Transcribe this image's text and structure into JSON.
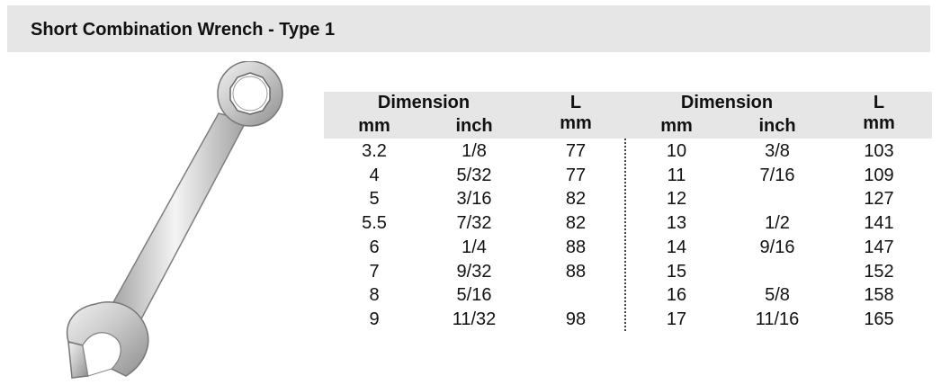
{
  "header": {
    "title": "Short Combination Wrench - Type 1"
  },
  "image": {
    "icon": "combination-wrench"
  },
  "table": {
    "group_headers": [
      "Dimension",
      "L",
      "Dimension",
      "L"
    ],
    "sub_headers": [
      "mm",
      "inch",
      "mm",
      "mm",
      "inch",
      "mm"
    ],
    "rows": [
      [
        "3.2",
        "1/8",
        "77",
        "10",
        "3/8",
        "103"
      ],
      [
        "4",
        "5/32",
        "77",
        "11",
        "7/16",
        "109"
      ],
      [
        "5",
        "3/16",
        "82",
        "12",
        "",
        "127"
      ],
      [
        "5.5",
        "7/32",
        "82",
        "13",
        "1/2",
        "141"
      ],
      [
        "6",
        "1/4",
        "88",
        "14",
        "9/16",
        "147"
      ],
      [
        "7",
        "9/32",
        "88",
        "15",
        "",
        "152"
      ],
      [
        "8",
        "5/16",
        "",
        "16",
        "5/8",
        "158"
      ],
      [
        "9",
        "11/32",
        "98",
        "17",
        "11/16",
        "165"
      ]
    ]
  }
}
